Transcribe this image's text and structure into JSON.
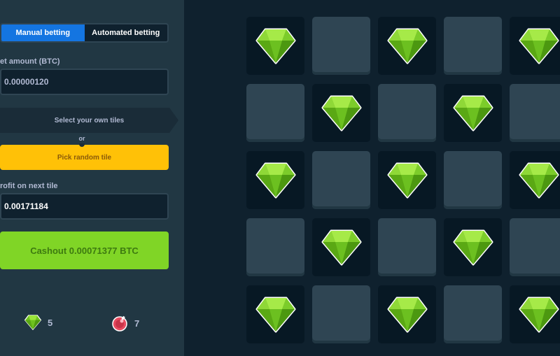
{
  "controls": {
    "manual_tab": "Manual betting",
    "auto_tab": "Automated betting",
    "bet_label": "et amount (BTC)",
    "bet_value": "0.00000120",
    "select_tiles": "Select your own tiles",
    "or": "or",
    "random_button": "Pick random tile",
    "profit_label": "rofit on next tile",
    "profit_value": "0.00171184",
    "cashout_button": "Cashout 0.00071377 BTC"
  },
  "stats": {
    "gems_count": "5",
    "mines_count": "7"
  },
  "board": {
    "tiles": [
      [
        "gem",
        "hidden",
        "gem",
        "hidden",
        "gem"
      ],
      [
        "hidden",
        "gem",
        "hidden",
        "gem",
        "hidden"
      ],
      [
        "gem",
        "hidden",
        "gem",
        "hidden",
        "gem"
      ],
      [
        "hidden",
        "gem",
        "hidden",
        "gem",
        "hidden"
      ],
      [
        "gem",
        "hidden",
        "gem",
        "hidden",
        "gem"
      ]
    ]
  },
  "colors": {
    "accent_blue": "#1475e1",
    "gem_green": "#80d526",
    "random_yellow": "#ffc107",
    "mine_red": "#e84a5f"
  },
  "icons": {
    "gem": "gem-icon",
    "mine": "mine-icon"
  }
}
